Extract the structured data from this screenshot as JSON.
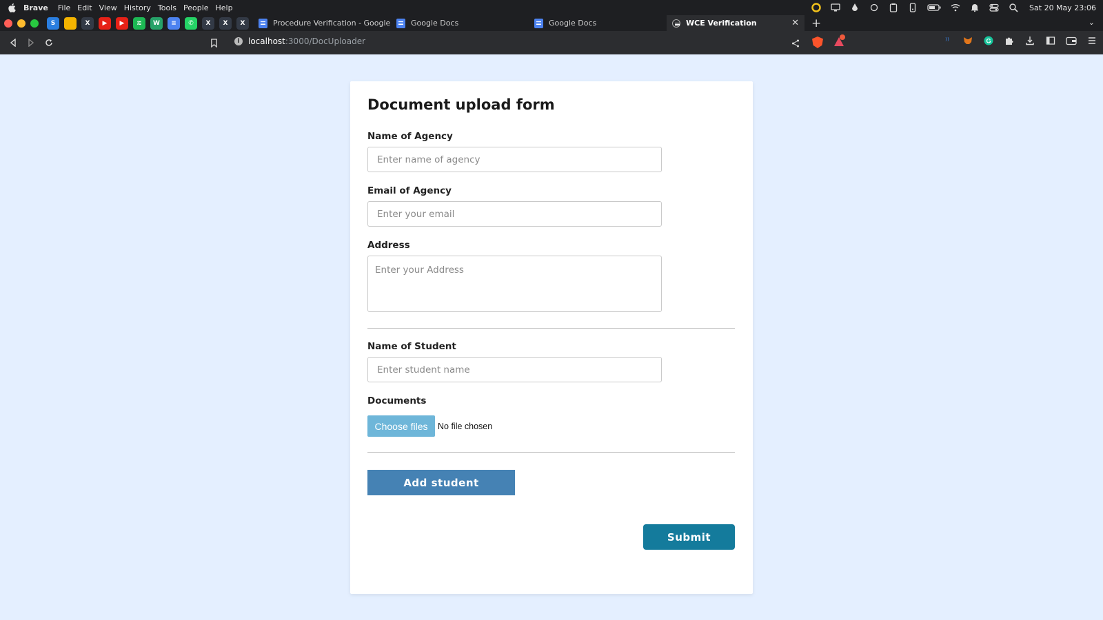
{
  "menubar": {
    "app_name": "Brave",
    "items": [
      "File",
      "Edit",
      "View",
      "History",
      "Tools",
      "People",
      "Help"
    ],
    "clock": "Sat 20 May 23:06"
  },
  "tabs": {
    "pinned": [
      {
        "icon": "s-icon",
        "glyph": "S",
        "color": "#2a7ee0"
      },
      {
        "icon": "keep-icon",
        "glyph": "",
        "color": "#f4b400"
      },
      {
        "icon": "x-icon",
        "glyph": "X",
        "color": "#333a46"
      },
      {
        "icon": "youtube-icon",
        "glyph": "▶",
        "color": "#e62117"
      },
      {
        "icon": "youtube-icon",
        "glyph": "▶",
        "color": "#e62117"
      },
      {
        "icon": "spotify-icon",
        "glyph": "≋",
        "color": "#1db954"
      },
      {
        "icon": "webflow-icon",
        "glyph": "W",
        "color": "#26a269"
      },
      {
        "icon": "docs-icon",
        "glyph": "≡",
        "color": "#4c82f0"
      },
      {
        "icon": "whatsapp-icon",
        "glyph": "✆",
        "color": "#25d366"
      },
      {
        "icon": "x-icon",
        "glyph": "X",
        "color": "#333a46"
      },
      {
        "icon": "x-icon",
        "glyph": "X",
        "color": "#333a46"
      },
      {
        "icon": "x-icon",
        "glyph": "X",
        "color": "#333a46"
      }
    ],
    "items": [
      {
        "label": "Procedure Verification - Google Do"
      },
      {
        "label": "Google Docs"
      },
      {
        "label": "Google Docs"
      },
      {
        "label": "WCE Verification"
      }
    ]
  },
  "toolbar": {
    "url_host": "localhost",
    "url_path": ":3000/DocUploader"
  },
  "form": {
    "title": "Document upload form",
    "agency_name_label": "Name of Agency",
    "agency_name_placeholder": "Enter name of agency",
    "agency_email_label": "Email of Agency",
    "agency_email_placeholder": "Enter your email",
    "address_label": "Address",
    "address_placeholder": "Enter your Address",
    "student_name_label": "Name of Student",
    "student_name_placeholder": "Enter student name",
    "documents_label": "Documents",
    "choose_files_label": "Choose files",
    "file_status": "No file chosen",
    "add_student_label": "Add student",
    "submit_label": "Submit"
  },
  "colors": {
    "page_bg": "#e4efff",
    "choose_files": "#6eb6d9",
    "add_student": "#4582b4",
    "submit": "#147b9c"
  }
}
